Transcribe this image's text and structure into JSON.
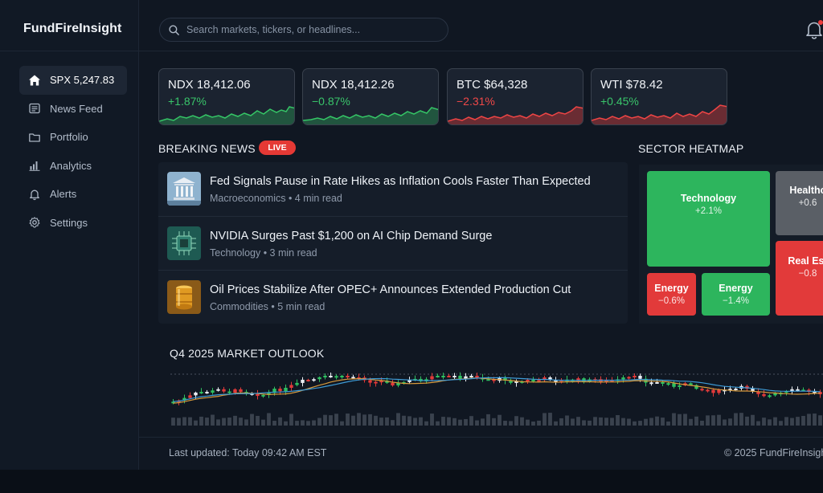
{
  "app": {
    "name": "FundFireInsight"
  },
  "search": {
    "placeholder": "Search markets, tickers, or headlines..."
  },
  "sidebar": {
    "items": [
      {
        "label": "SPX 5,247.83",
        "icon": "home-icon",
        "active": true
      },
      {
        "label": "News Feed",
        "icon": "newspaper-icon",
        "active": false
      },
      {
        "label": "Portfolio",
        "icon": "folder-icon",
        "active": false
      },
      {
        "label": "Analytics",
        "icon": "bar-chart-icon",
        "active": false
      },
      {
        "label": "Alerts",
        "icon": "bell-icon",
        "active": false
      },
      {
        "label": "Settings",
        "icon": "gear-icon",
        "active": false
      }
    ]
  },
  "tickers": [
    {
      "label": "NDX 18,412.06",
      "change": "+1.87%",
      "direction": "up"
    },
    {
      "label": "NDX 18,412.26",
      "change": "−0.87%",
      "direction": "up"
    },
    {
      "label": "BTC $64,328",
      "change": "−2.31%",
      "direction": "down"
    },
    {
      "label": "WTI $78.42",
      "change": "+0.45%",
      "direction": "up"
    }
  ],
  "news": {
    "title": "BREAKING NEWS",
    "badge": "LIVE",
    "items": [
      {
        "headline": "Fed Signals Pause in Rate Hikes as Inflation Cools Faster Than Expected",
        "meta": "Macroeconomics • 4 min read",
        "thumb": "bank-icon"
      },
      {
        "headline": "NVIDIA Surges Past $1,200 on AI Chip Demand Surge",
        "meta": "Technology • 3 min read",
        "thumb": "chip-icon"
      },
      {
        "headline": "Oil Prices Stabilize After OPEC+ Announces Extended Production Cut",
        "meta": "Commodities • 5 min read",
        "thumb": "oil-barrel-icon"
      }
    ]
  },
  "heatmap": {
    "title": "SECTOR HEATMAP",
    "cells": [
      {
        "name": "Technology",
        "change": "+2.1%",
        "color": "#2db55d"
      },
      {
        "name": "Healthc",
        "change": "+0.6",
        "color": "#5a5f66"
      },
      {
        "name": "Real Est",
        "change": "−0.8",
        "color": "#e23a3a"
      },
      {
        "name": "Energy",
        "change": "−0.6%",
        "color": "#e23a3a"
      },
      {
        "name": "Energy",
        "change": "−1.4%",
        "color": "#2db55d"
      }
    ]
  },
  "outlook": {
    "title": "Q4 2025 MARKET OUTLOOK"
  },
  "footer": {
    "updated": "Last updated: Today 09:42 AM EST",
    "copyright": "© 2025 FundFireInsigh"
  },
  "colors": {
    "up": "#39c46a",
    "down": "#f04848",
    "accent_live": "#e53935"
  }
}
